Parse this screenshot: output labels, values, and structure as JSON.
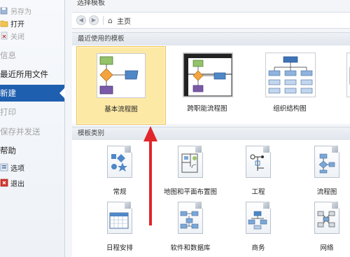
{
  "sidebar": {
    "items": [
      {
        "label": "另存为",
        "style": "sub dim",
        "icon": "save-as-icon"
      },
      {
        "label": "打开",
        "style": "sub",
        "icon": "open-folder-icon"
      },
      {
        "label": "关闭",
        "style": "sub dim",
        "icon": "close-file-icon"
      },
      {
        "label": "信息",
        "style": "big dim",
        "icon": ""
      },
      {
        "label": "最近所用文件",
        "style": "big",
        "icon": ""
      },
      {
        "label": "新建",
        "style": "active",
        "icon": ""
      },
      {
        "label": "打印",
        "style": "big dim",
        "icon": ""
      },
      {
        "label": "保存并发送",
        "style": "big dim",
        "icon": ""
      },
      {
        "label": "帮助",
        "style": "big",
        "icon": ""
      },
      {
        "label": "选项",
        "style": "sub",
        "icon": "options-icon"
      },
      {
        "label": "退出",
        "style": "sub",
        "icon": "exit-icon"
      }
    ]
  },
  "main": {
    "title": "选择模板",
    "nav": {
      "back": "◀",
      "forward": "▶",
      "home_icon": "⌂",
      "breadcrumb": "主页"
    },
    "recent_header": "最近使用的模板",
    "recent": [
      {
        "label": "基本流程图",
        "selected": true
      },
      {
        "label": "跨职能流程图",
        "selected": false
      },
      {
        "label": "组织结构图",
        "selected": false
      },
      {
        "label": "",
        "selected": false
      }
    ],
    "category_header": "模板类别",
    "categories": [
      {
        "label": "常规",
        "icon": "general-shapes-icon"
      },
      {
        "label": "地图和平面布置图",
        "icon": "map-floorplan-icon"
      },
      {
        "label": "工程",
        "icon": "engineering-icon"
      },
      {
        "label": "流程图",
        "icon": "flowchart-icon"
      },
      {
        "label": "日程安排",
        "icon": "schedule-icon"
      },
      {
        "label": "软件和数据库",
        "icon": "software-database-icon"
      },
      {
        "label": "商务",
        "icon": "business-icon"
      },
      {
        "label": "网络",
        "icon": "network-icon"
      }
    ]
  },
  "colors": {
    "accent": "#1f5fb0",
    "selection": "#fde9a6",
    "annotation_arrow": "#e0262a"
  }
}
